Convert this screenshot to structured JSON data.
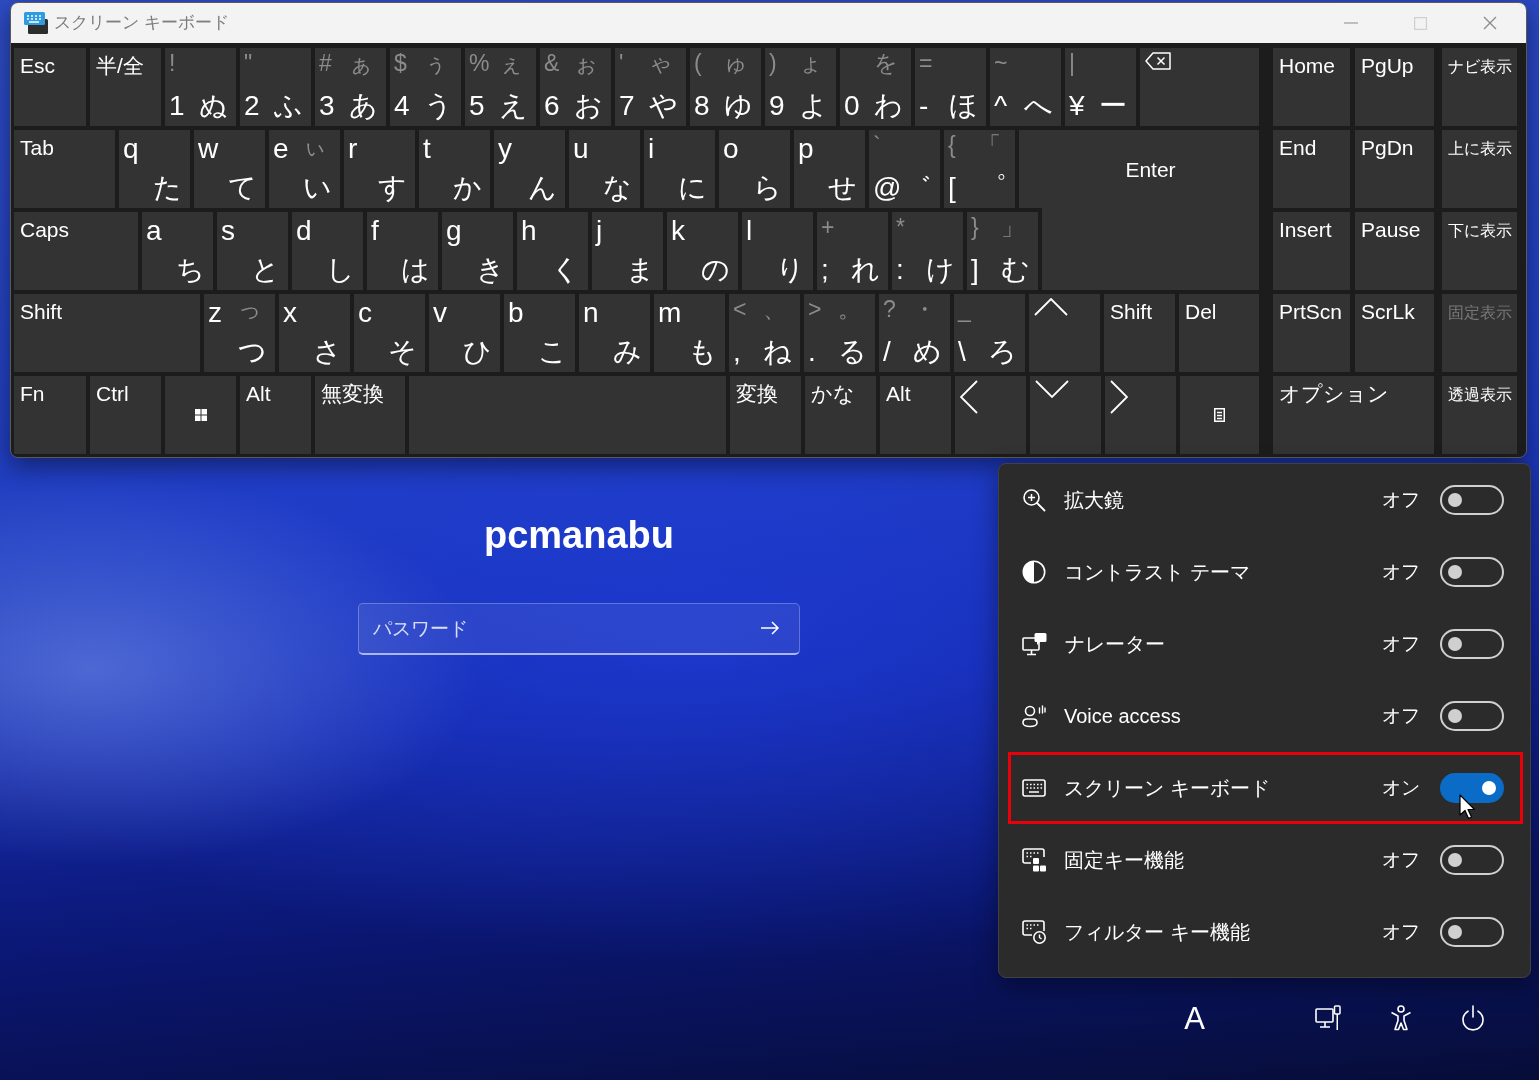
{
  "window": {
    "title": "スクリーン キーボード",
    "can_maximize": false
  },
  "keyboard": {
    "rows": [
      {
        "keys": [
          {
            "kind": "label",
            "label": "Esc"
          },
          {
            "kind": "label",
            "label": "半/全"
          },
          {
            "kind": "number",
            "shift": "!",
            "main": "1",
            "kana": "ぬ"
          },
          {
            "kind": "number",
            "shift": "\"",
            "main": "2",
            "kana": "ふ"
          },
          {
            "kind": "number",
            "shift": "#",
            "shift_kana": "ぁ",
            "main": "3",
            "kana": "あ"
          },
          {
            "kind": "number",
            "shift": "$",
            "shift_kana": "ぅ",
            "main": "4",
            "kana": "う"
          },
          {
            "kind": "number",
            "shift": "%",
            "shift_kana": "ぇ",
            "main": "5",
            "kana": "え"
          },
          {
            "kind": "number",
            "shift": "&",
            "shift_kana": "ぉ",
            "main": "6",
            "kana": "お"
          },
          {
            "kind": "number",
            "shift": "'",
            "shift_kana": "ゃ",
            "main": "7",
            "kana": "や"
          },
          {
            "kind": "number",
            "shift": "(",
            "shift_kana": "ゅ",
            "main": "8",
            "kana": "ゆ"
          },
          {
            "kind": "number",
            "shift": ")",
            "shift_kana": "ょ",
            "main": "9",
            "kana": "よ"
          },
          {
            "kind": "number",
            "shift_kana": "を",
            "main": "0",
            "kana": "わ"
          },
          {
            "kind": "number",
            "shift": "=",
            "main": "-",
            "kana": "ほ"
          },
          {
            "kind": "number",
            "shift": "~",
            "main": "^",
            "kana": "へ"
          },
          {
            "kind": "number",
            "shift": "|",
            "main": "¥",
            "kana": "ー"
          },
          {
            "kind": "backspace"
          }
        ]
      },
      {
        "keys": [
          {
            "kind": "label",
            "label": "Tab"
          },
          {
            "kind": "letter",
            "main": "q",
            "kana": "た"
          },
          {
            "kind": "letter",
            "main": "w",
            "kana": "て"
          },
          {
            "kind": "letter",
            "main": "e",
            "shift_kana": "ぃ",
            "kana": "い"
          },
          {
            "kind": "letter",
            "main": "r",
            "kana": "す"
          },
          {
            "kind": "letter",
            "main": "t",
            "kana": "か"
          },
          {
            "kind": "letter",
            "main": "y",
            "kana": "ん"
          },
          {
            "kind": "letter",
            "main": "u",
            "kana": "な"
          },
          {
            "kind": "letter",
            "main": "i",
            "kana": "に"
          },
          {
            "kind": "letter",
            "main": "o",
            "kana": "ら"
          },
          {
            "kind": "letter",
            "main": "p",
            "kana": "せ"
          },
          {
            "kind": "number",
            "shift": "`",
            "main": "@",
            "kana": "゛"
          },
          {
            "kind": "number",
            "shift": "{",
            "shift_kana": "「",
            "main": "[",
            "kana": "゜"
          },
          {
            "kind": "enter",
            "label": "Enter"
          }
        ]
      },
      {
        "keys": [
          {
            "kind": "label",
            "label": "Caps"
          },
          {
            "kind": "letter",
            "main": "a",
            "kana": "ち"
          },
          {
            "kind": "letter",
            "main": "s",
            "kana": "と"
          },
          {
            "kind": "letter",
            "main": "d",
            "kana": "し"
          },
          {
            "kind": "letter",
            "main": "f",
            "kana": "は"
          },
          {
            "kind": "letter",
            "main": "g",
            "kana": "き"
          },
          {
            "kind": "letter",
            "main": "h",
            "kana": "く"
          },
          {
            "kind": "letter",
            "main": "j",
            "kana": "ま"
          },
          {
            "kind": "letter",
            "main": "k",
            "kana": "の"
          },
          {
            "kind": "letter",
            "main": "l",
            "kana": "り"
          },
          {
            "kind": "number",
            "shift": "+",
            "main": ";",
            "kana": "れ"
          },
          {
            "kind": "number",
            "shift": "*",
            "main": ":",
            "kana": "け"
          },
          {
            "kind": "number",
            "shift": "}",
            "shift_kana": "」",
            "main": "]",
            "kana": "む"
          }
        ]
      },
      {
        "keys": [
          {
            "kind": "label",
            "label": "Shift"
          },
          {
            "kind": "letter",
            "main": "z",
            "shift_kana": "っ",
            "kana": "つ"
          },
          {
            "kind": "letter",
            "main": "x",
            "kana": "さ"
          },
          {
            "kind": "letter",
            "main": "c",
            "kana": "そ"
          },
          {
            "kind": "letter",
            "main": "v",
            "kana": "ひ"
          },
          {
            "kind": "letter",
            "main": "b",
            "kana": "こ"
          },
          {
            "kind": "letter",
            "main": "n",
            "kana": "み"
          },
          {
            "kind": "letter",
            "main": "m",
            "kana": "も"
          },
          {
            "kind": "number",
            "shift": "<",
            "shift_kana": "、",
            "main": ",",
            "kana": "ね"
          },
          {
            "kind": "number",
            "shift": ">",
            "shift_kana": "。",
            "main": ".",
            "kana": "る"
          },
          {
            "kind": "number",
            "shift": "?",
            "shift_kana": "・",
            "main": "/",
            "kana": "め"
          },
          {
            "kind": "number",
            "shift": "_",
            "main": "\\",
            "kana": "ろ"
          },
          {
            "kind": "up"
          },
          {
            "kind": "label",
            "label": "Shift"
          },
          {
            "kind": "label",
            "label": "Del"
          }
        ]
      },
      {
        "keys": [
          {
            "kind": "label",
            "label": "Fn"
          },
          {
            "kind": "label",
            "label": "Ctrl"
          },
          {
            "kind": "windows"
          },
          {
            "kind": "label",
            "label": "Alt"
          },
          {
            "kind": "label",
            "label": "無変換"
          },
          {
            "kind": "space"
          },
          {
            "kind": "label",
            "label": "変換"
          },
          {
            "kind": "label",
            "label": "かな"
          },
          {
            "kind": "label",
            "label": "Alt"
          },
          {
            "kind": "left"
          },
          {
            "kind": "down"
          },
          {
            "kind": "right"
          },
          {
            "kind": "menu"
          }
        ]
      }
    ],
    "side_rows": [
      {
        "keys": [
          {
            "kind": "nav",
            "label": "Home",
            "disabled": false
          },
          {
            "kind": "nav",
            "label": "PgUp",
            "disabled": false
          },
          {
            "kind": "view",
            "label": "ナビ表示",
            "disabled": false
          }
        ]
      },
      {
        "keys": [
          {
            "kind": "nav",
            "label": "End",
            "disabled": false
          },
          {
            "kind": "nav",
            "label": "PgDn",
            "disabled": false
          },
          {
            "kind": "view",
            "label": "上に表示",
            "disabled": false
          }
        ]
      },
      {
        "keys": [
          {
            "kind": "nav",
            "label": "Insert",
            "disabled": false
          },
          {
            "kind": "nav",
            "label": "Pause",
            "disabled": false
          },
          {
            "kind": "view",
            "label": "下に表示",
            "disabled": false
          }
        ]
      },
      {
        "keys": [
          {
            "kind": "nav",
            "label": "PrtScn",
            "disabled": false
          },
          {
            "kind": "nav",
            "label": "ScrLk",
            "disabled": false
          },
          {
            "kind": "view",
            "label": "固定表示",
            "disabled": true
          }
        ]
      },
      {
        "keys": [
          {
            "kind": "nav",
            "label": "オプション",
            "disabled": false
          },
          {
            "kind": "view",
            "label": "透過表示",
            "disabled": false
          }
        ]
      }
    ]
  },
  "login": {
    "username": "pcmanabu",
    "password": {
      "placeholder": "パスワード"
    }
  },
  "accessibility": {
    "items": [
      {
        "label": "拡大鏡",
        "state_label": "オフ",
        "on": false,
        "highlighted": false
      },
      {
        "label": "コントラスト テーマ",
        "state_label": "オフ",
        "on": false,
        "highlighted": false
      },
      {
        "label": "ナレーター",
        "state_label": "オフ",
        "on": false,
        "highlighted": false
      },
      {
        "label": "Voice access",
        "state_label": "オフ",
        "on": false,
        "highlighted": false
      },
      {
        "label": "スクリーン キーボード",
        "state_label": "オン",
        "on": true,
        "highlighted": true
      },
      {
        "label": "固定キー機能",
        "state_label": "オフ",
        "on": false,
        "highlighted": false
      },
      {
        "label": "フィルター キー機能",
        "state_label": "オフ",
        "on": false,
        "highlighted": false
      }
    ]
  },
  "status_bar": {
    "input_indicator": "A"
  }
}
